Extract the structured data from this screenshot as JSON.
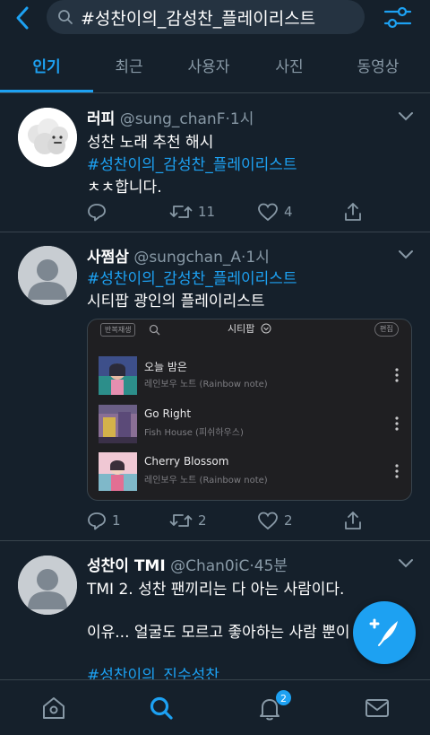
{
  "search": {
    "query": "#성찬이의_감성찬_플레이리스트"
  },
  "tabs": [
    {
      "label": "인기",
      "active": true
    },
    {
      "label": "최근"
    },
    {
      "label": "사용자"
    },
    {
      "label": "사진"
    },
    {
      "label": "동영상"
    }
  ],
  "colors": {
    "background": "#15202b",
    "accent": "#1da1f2",
    "muted": "#8899a6",
    "divider": "#38444d"
  },
  "tweets": [
    {
      "name": "러피",
      "handle": "@sung_chanF",
      "dot": "·",
      "time": "1시",
      "lines": [
        "성찬 노래 추천 해시",
        "#성찬이의_감성찬_플레이리스트",
        "ㅊㅊ합니다."
      ],
      "replies": "",
      "retweets": "11",
      "likes": "4"
    },
    {
      "name": "사쩜삼",
      "handle": "@sungchan_A",
      "dot": "·",
      "time": "1시",
      "lines": [
        "#성찬이의_감성찬_플레이리스트",
        "시티팝 광인의 플레이리스트"
      ],
      "replies": "1",
      "retweets": "2",
      "likes": "2",
      "media": {
        "repeat_label": "반복재생",
        "playlist_title": "시티팝",
        "edit_label": "편집",
        "songs": [
          {
            "title": "오늘 밤은",
            "artist": "레인보우 노트 (Rainbow note)"
          },
          {
            "title": "Go Right",
            "artist": "Fish House (피쉬하우스)"
          },
          {
            "title": "Cherry Blossom",
            "artist": "레인보우 노트 (Rainbow note)"
          }
        ]
      }
    },
    {
      "name": "성찬이 TMI",
      "handle": "@Chan0iC",
      "dot": "·",
      "time": "45분",
      "lines": [
        "TMI 2. 성찬 팬끼리는 다 아는 사람이다.",
        "",
        "이유... 얼굴도 모르고 좋아하는 사람 뿐이",
        "",
        "#성찬이의_진수성찬"
      ]
    }
  ],
  "bottom_nav": {
    "notifications_badge": "2"
  },
  "icons": [
    "back-arrow-icon",
    "search-icon",
    "filter-sliders-icon",
    "chevron-down-icon",
    "reply-icon",
    "retweet-icon",
    "like-icon",
    "share-icon",
    "compose-feather-icon",
    "home-icon",
    "search-nav-icon",
    "bell-icon",
    "mail-icon"
  ]
}
